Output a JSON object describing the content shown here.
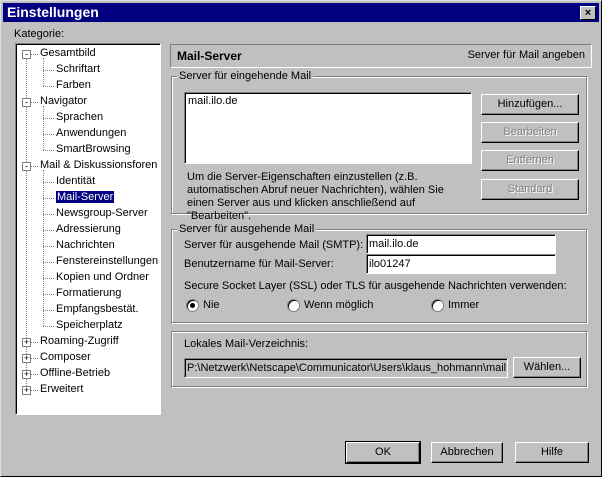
{
  "window": {
    "title": "Einstellungen",
    "close_glyph": "×"
  },
  "category_label": "Kategorie:",
  "tree": [
    {
      "label": "Gesamtbild",
      "level": 0,
      "expander": "-"
    },
    {
      "label": "Schriftart",
      "level": 1
    },
    {
      "label": "Farben",
      "level": 1
    },
    {
      "label": "Navigator",
      "level": 0,
      "expander": "-"
    },
    {
      "label": "Sprachen",
      "level": 1
    },
    {
      "label": "Anwendungen",
      "level": 1
    },
    {
      "label": "SmartBrowsing",
      "level": 1
    },
    {
      "label": "Mail & Diskussionsforen",
      "level": 0,
      "expander": "-"
    },
    {
      "label": "Identität",
      "level": 1
    },
    {
      "label": "Mail-Server",
      "level": 1,
      "selected": true
    },
    {
      "label": "Newsgroup-Server",
      "level": 1
    },
    {
      "label": "Adressierung",
      "level": 1
    },
    {
      "label": "Nachrichten",
      "level": 1
    },
    {
      "label": "Fenstereinstellungen",
      "level": 1
    },
    {
      "label": "Kopien und Ordner",
      "level": 1
    },
    {
      "label": "Formatierung",
      "level": 1
    },
    {
      "label": "Empfangsbestät.",
      "level": 1
    },
    {
      "label": "Speicherplatz",
      "level": 1
    },
    {
      "label": "Roaming-Zugriff",
      "level": 0,
      "expander": "+"
    },
    {
      "label": "Composer",
      "level": 0,
      "expander": "+"
    },
    {
      "label": "Offline-Betrieb",
      "level": 0,
      "expander": "+"
    },
    {
      "label": "Erweitert",
      "level": 0,
      "expander": "+"
    }
  ],
  "header": {
    "title": "Mail-Server",
    "subtitle": "Server für Mail angeben"
  },
  "incoming": {
    "group_label": "Server für eingehende Mail",
    "servers": [
      "mail.ilo.de"
    ],
    "buttons": {
      "add": "Hinzufügen...",
      "edit": "Bearbeiten",
      "remove": "Entfernen",
      "default": "Standard"
    },
    "hint": "Um die Server-Eigenschaften einzustellen (z.B. automatischen Abruf neuer Nachrichten), wählen Sie einen Server aus und klicken anschließend auf \"Bearbeiten\"."
  },
  "outgoing": {
    "group_label": "Server für ausgehende Mail",
    "smtp_label": "Server für ausgehende Mail (SMTP):",
    "smtp_value": "mail.ilo.de",
    "user_label": "Benutzername für Mail-Server:",
    "user_value": "ilo01247",
    "ssl_label": "Secure Socket Layer (SSL) oder TLS für ausgehende Nachrichten verwenden:",
    "options": [
      "Nie",
      "Wenn möglich",
      "Immer"
    ],
    "selected_option": "Nie"
  },
  "local_dir": {
    "group_label": "Lokales Mail-Verzeichnis:",
    "path": "P:\\Netzwerk\\Netscape\\Communicator\\Users\\klaus_hohmann\\mail",
    "choose_button": "Wählen..."
  },
  "footer": {
    "ok": "OK",
    "cancel": "Abbrechen",
    "help": "Hilfe"
  }
}
